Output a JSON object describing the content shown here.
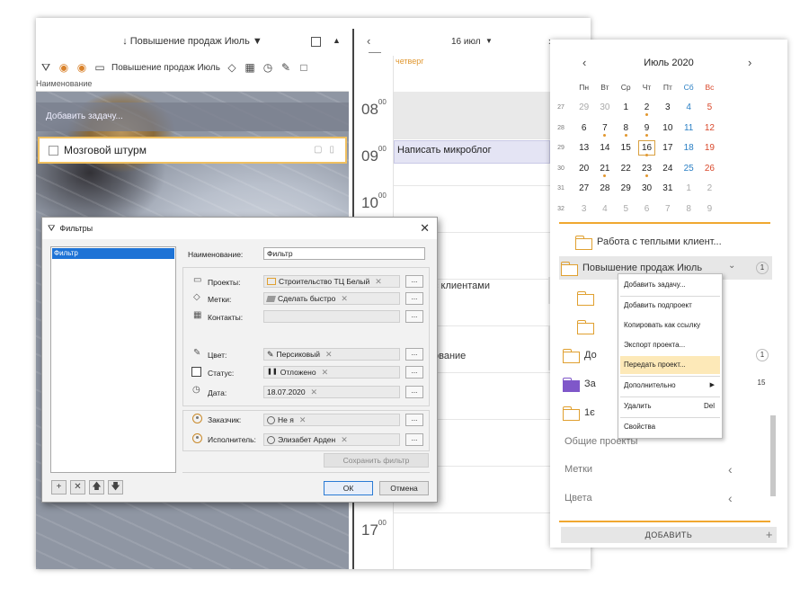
{
  "task_pane": {
    "project_title": "↓ Повышение продаж Июль ▼",
    "toolbar_project": "Повышение продаж Июль",
    "column_header": "Наименование",
    "add_task_placeholder": "Добавить задачу...",
    "task_name": "Мозговой штурм"
  },
  "day_view": {
    "date": "16 июл",
    "weekday": "четверг",
    "hours": [
      {
        "h": "08",
        "m": "00"
      },
      {
        "h": "09",
        "m": "00"
      },
      {
        "h": "10",
        "m": "00"
      },
      {
        "h": "17",
        "m": "00"
      }
    ],
    "event_1": "Написать микроблог",
    "event_2_partial": "с клиентами",
    "event_3_partial": "ование"
  },
  "mini_calendar": {
    "title": "Июль 2020",
    "weekdays": [
      "Пн",
      "Вт",
      "Ср",
      "Чт",
      "Пт",
      "Сб",
      "Вс"
    ],
    "weeks": [
      {
        "wk": "27",
        "days": [
          "29",
          "30",
          "1",
          "2",
          "3",
          "4",
          "5"
        ]
      },
      {
        "wk": "28",
        "days": [
          "6",
          "7",
          "8",
          "9",
          "10",
          "11",
          "12"
        ]
      },
      {
        "wk": "29",
        "days": [
          "13",
          "14",
          "15",
          "16",
          "17",
          "18",
          "19"
        ]
      },
      {
        "wk": "30",
        "days": [
          "20",
          "21",
          "22",
          "23",
          "24",
          "25",
          "26"
        ]
      },
      {
        "wk": "31",
        "days": [
          "27",
          "28",
          "29",
          "30",
          "31",
          "1",
          "2"
        ]
      },
      {
        "wk": "32",
        "days": [
          "3",
          "4",
          "5",
          "6",
          "7",
          "8",
          "9"
        ]
      }
    ]
  },
  "projects": {
    "item_1": "Работа с теплыми клиент...",
    "item_2": "Повышение продаж Июль",
    "item_2_count": "1",
    "item_3_partial": "До",
    "item_3_count": "1",
    "item_4_partial": "За",
    "item_4_count": "15",
    "item_5_partial": "1є",
    "common": "Общие проекты",
    "tags": "Метки",
    "colors": "Цвета",
    "add_button": "ДОБАВИТЬ"
  },
  "context_menu": {
    "items": [
      "Добавить задачу...",
      "Добавить подпроект",
      "Копировать как ссылку",
      "Экспорт проекта...",
      "Передать проект...",
      "Дополнительно",
      "Удалить",
      "Свойства"
    ],
    "delete_shortcut": "Del"
  },
  "filter_dialog": {
    "title": "Фильтры",
    "list_item": "Фильтр",
    "name_label": "Наименование:",
    "name_value": "Фильтр",
    "projects_label": "Проекты:",
    "projects_value": "Строительство ТЦ Белый",
    "tags_label": "Метки:",
    "tags_value": "Сделать быстро",
    "contacts_label": "Контакты:",
    "color_label": "Цвет:",
    "color_value": "Персиковый",
    "status_label": "Статус:",
    "status_value": "Отложено",
    "date_label": "Дата:",
    "date_value": "18.07.2020",
    "customer_label": "Заказчик:",
    "customer_value": "Не я",
    "assignee_label": "Исполнитель:",
    "assignee_value": "Элизабет Арден",
    "dots": "...",
    "save_filter": "Сохранить фильтр",
    "ok": "ОК",
    "cancel": "Отмена"
  }
}
